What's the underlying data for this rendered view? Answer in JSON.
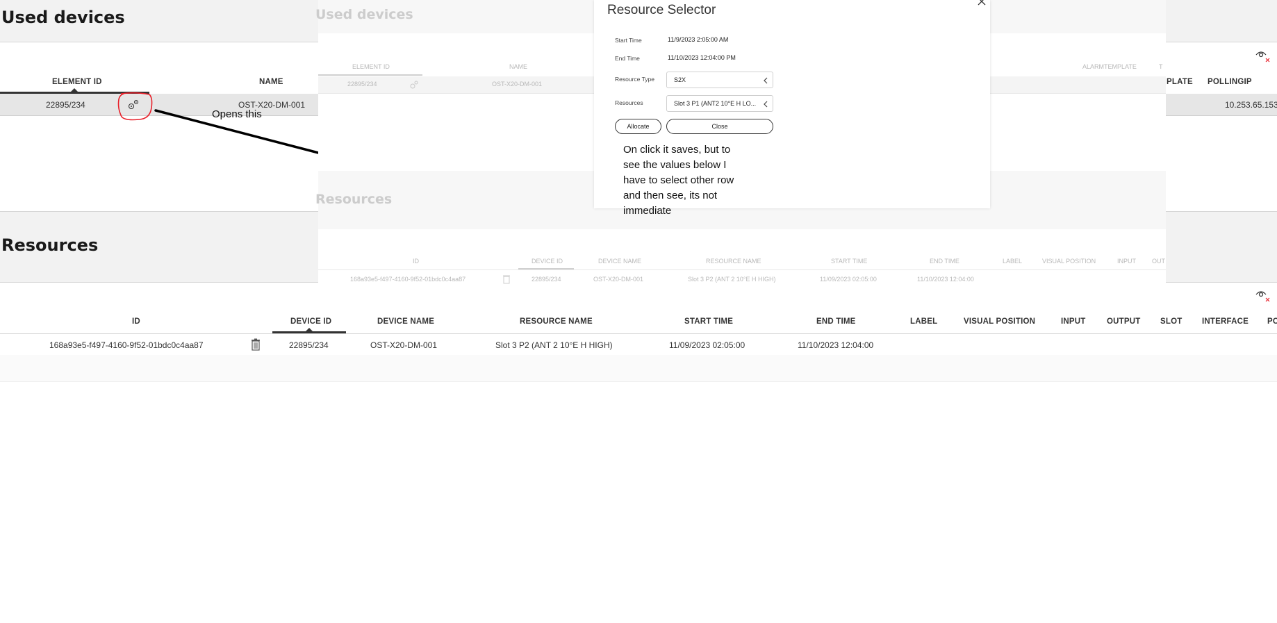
{
  "used_devices": {
    "title": "Used devices",
    "columns": {
      "element_id": "ELEMENT ID",
      "name": "NAME",
      "template": "PLATE",
      "pollingip": "POLLINGIP"
    },
    "row": {
      "element_id": "22895/234",
      "name": "OST-X20-DM-001",
      "pollingip": "10.253.65.153"
    }
  },
  "resources": {
    "title": "Resources",
    "columns": [
      "ID",
      "DEVICE ID",
      "DEVICE NAME",
      "RESOURCE NAME",
      "START TIME",
      "END TIME",
      "LABEL",
      "VISUAL POSITION",
      "INPUT",
      "OUTPUT",
      "SLOT",
      "INTERFACE",
      "PO"
    ],
    "row": {
      "id": "168a93e5-f497-4160-9f52-01bdc0c4aa87",
      "device_id": "22895/234",
      "device_name": "OST-X20-DM-001",
      "resource_name": "Slot 3 P2 (ANT 2 10°E H HIGH)",
      "start_time": "11/09/2023 02:05:00",
      "end_time": "11/10/2023 12:04:00"
    }
  },
  "annotation": {
    "opens_this": "Opens this",
    "note_lines": [
      "On click it saves, but to",
      "see the values below I",
      "have to select other row",
      "and then see, its not",
      "immediate"
    ]
  },
  "ghost_screenshot": {
    "used_devices_title": "Used devices",
    "resources_title": "Resources",
    "ud_columns": {
      "element_id": "ELEMENT ID",
      "name": "NAME",
      "alarmtemplate": "ALARMTEMPLATE",
      "t": "T"
    },
    "ud_row": {
      "element_id": "22895/234",
      "name": "OST-X20-DM-001"
    },
    "res_columns": [
      "ID",
      "DEVICE ID",
      "DEVICE NAME",
      "RESOURCE NAME",
      "START TIME",
      "END TIME",
      "LABEL",
      "VISUAL POSITION",
      "INPUT",
      "OUT"
    ],
    "res_row": {
      "id": "168a93e5-f497-4160-9f52-01bdc0c4aa87",
      "device_id": "22895/234",
      "device_name": "OST-X20-DM-001",
      "resource_name": "Slot 3 P2 (ANT 2 10°E H HIGH)",
      "start_time": "11/09/2023 02:05:00",
      "end_time": "11/10/2023 12:04:00"
    }
  },
  "resource_selector": {
    "title": "Resource Selector",
    "start_time_label": "Start Time",
    "start_time_value": "11/9/2023 2:05:00 AM",
    "end_time_label": "End Time",
    "end_time_value": "11/10/2023 12:04:00 PM",
    "resource_type_label": "Resource Type",
    "resource_type_value": "S2X",
    "resources_label": "Resources",
    "resources_value": "Slot 3 P1 (ANT2 10°E H LO...",
    "allocate_label": "Allocate",
    "close_label": "Close"
  },
  "colors": {
    "band": "#f2f2f2",
    "row_highlight": "#e6e6e6",
    "annotation_red": "#e8202a",
    "arrow": "#000000"
  }
}
